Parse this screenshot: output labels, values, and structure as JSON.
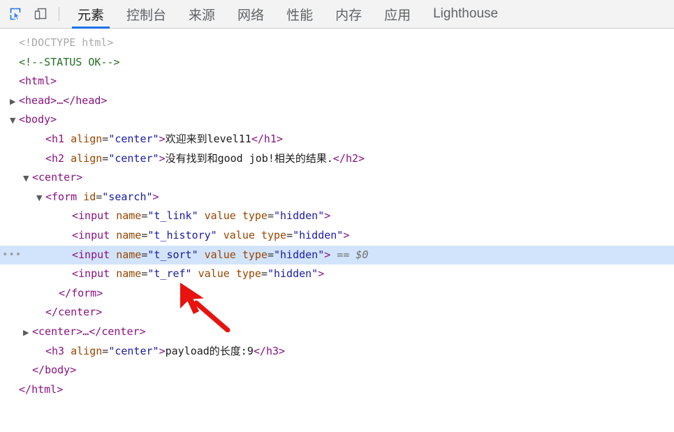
{
  "toolbar": {
    "icons": [
      {
        "name": "inspect-element-icon",
        "label": "Inspect element",
        "active": true
      },
      {
        "name": "device-toolbar-icon",
        "label": "Toggle device toolbar",
        "active": false
      }
    ],
    "tabs": [
      {
        "label": "元素",
        "active": true
      },
      {
        "label": "控制台",
        "active": false
      },
      {
        "label": "来源",
        "active": false
      },
      {
        "label": "网络",
        "active": false
      },
      {
        "label": "性能",
        "active": false
      },
      {
        "label": "内存",
        "active": false
      },
      {
        "label": "应用",
        "active": false
      },
      {
        "label": "Lighthouse",
        "active": false
      }
    ],
    "accent_color": "#1a73e8",
    "background_color": "#f3f3f3"
  },
  "dom_tree": {
    "selection_color": "#d2e4fb",
    "selected_suffix": "== $0",
    "ellipsis_marker": "•••",
    "rows": [
      {
        "twisty": "",
        "indent": 0,
        "segments": [
          {
            "cls": "doctype",
            "t": "<!DOCTYPE html>"
          }
        ]
      },
      {
        "twisty": "",
        "indent": 0,
        "segments": [
          {
            "cls": "comment",
            "t": "<!--STATUS OK-->"
          }
        ]
      },
      {
        "twisty": "",
        "indent": 0,
        "segments": [
          {
            "cls": "punct",
            "t": "<"
          },
          {
            "cls": "tag",
            "t": "html"
          },
          {
            "cls": "punct",
            "t": ">"
          }
        ]
      },
      {
        "twisty": "right",
        "indent": 0,
        "segments": [
          {
            "cls": "punct",
            "t": "<"
          },
          {
            "cls": "tag",
            "t": "head"
          },
          {
            "cls": "punct",
            "t": ">"
          },
          {
            "cls": "dots",
            "t": "…"
          },
          {
            "cls": "punct",
            "t": "</"
          },
          {
            "cls": "tag",
            "t": "head"
          },
          {
            "cls": "punct",
            "t": ">"
          }
        ]
      },
      {
        "twisty": "down",
        "indent": 0,
        "segments": [
          {
            "cls": "punct",
            "t": "<"
          },
          {
            "cls": "tag",
            "t": "body"
          },
          {
            "cls": "punct",
            "t": ">"
          }
        ]
      },
      {
        "twisty": "",
        "indent": 2,
        "segments": [
          {
            "cls": "punct",
            "t": "<"
          },
          {
            "cls": "tag",
            "t": "h1"
          },
          {
            "cls": "plain",
            "t": " "
          },
          {
            "cls": "attr",
            "t": "align"
          },
          {
            "cls": "plain",
            "t": "="
          },
          {
            "cls": "val",
            "t": "\"center\""
          },
          {
            "cls": "punct",
            "t": ">"
          },
          {
            "cls": "text",
            "t": "欢迎来到level11"
          },
          {
            "cls": "punct",
            "t": "</"
          },
          {
            "cls": "tag",
            "t": "h1"
          },
          {
            "cls": "punct",
            "t": ">"
          }
        ]
      },
      {
        "twisty": "",
        "indent": 2,
        "segments": [
          {
            "cls": "punct",
            "t": "<"
          },
          {
            "cls": "tag",
            "t": "h2"
          },
          {
            "cls": "plain",
            "t": " "
          },
          {
            "cls": "attr",
            "t": "align"
          },
          {
            "cls": "plain",
            "t": "="
          },
          {
            "cls": "val",
            "t": "\"center\""
          },
          {
            "cls": "punct",
            "t": ">"
          },
          {
            "cls": "text",
            "t": "没有找到和good job!相关的结果."
          },
          {
            "cls": "punct",
            "t": "</"
          },
          {
            "cls": "tag",
            "t": "h2"
          },
          {
            "cls": "punct",
            "t": ">"
          }
        ]
      },
      {
        "twisty": "down",
        "indent": 1,
        "segments": [
          {
            "cls": "punct",
            "t": "<"
          },
          {
            "cls": "tag",
            "t": "center"
          },
          {
            "cls": "punct",
            "t": ">"
          }
        ]
      },
      {
        "twisty": "down",
        "indent": 2,
        "segments": [
          {
            "cls": "punct",
            "t": "<"
          },
          {
            "cls": "tag",
            "t": "form"
          },
          {
            "cls": "plain",
            "t": " "
          },
          {
            "cls": "attr",
            "t": "id"
          },
          {
            "cls": "plain",
            "t": "="
          },
          {
            "cls": "val",
            "t": "\"search\""
          },
          {
            "cls": "punct",
            "t": ">"
          }
        ]
      },
      {
        "twisty": "",
        "indent": 4,
        "segments": [
          {
            "cls": "punct",
            "t": "<"
          },
          {
            "cls": "tag",
            "t": "input"
          },
          {
            "cls": "plain",
            "t": " "
          },
          {
            "cls": "attr",
            "t": "name"
          },
          {
            "cls": "plain",
            "t": "="
          },
          {
            "cls": "val",
            "t": "\"t_link\""
          },
          {
            "cls": "plain",
            "t": " "
          },
          {
            "cls": "attr",
            "t": "value"
          },
          {
            "cls": "plain",
            "t": " "
          },
          {
            "cls": "attr",
            "t": "type"
          },
          {
            "cls": "plain",
            "t": "="
          },
          {
            "cls": "val",
            "t": "\"hidden\""
          },
          {
            "cls": "punct",
            "t": ">"
          }
        ]
      },
      {
        "twisty": "",
        "indent": 4,
        "segments": [
          {
            "cls": "punct",
            "t": "<"
          },
          {
            "cls": "tag",
            "t": "input"
          },
          {
            "cls": "plain",
            "t": " "
          },
          {
            "cls": "attr",
            "t": "name"
          },
          {
            "cls": "plain",
            "t": "="
          },
          {
            "cls": "val",
            "t": "\"t_history\""
          },
          {
            "cls": "plain",
            "t": " "
          },
          {
            "cls": "attr",
            "t": "value"
          },
          {
            "cls": "plain",
            "t": " "
          },
          {
            "cls": "attr",
            "t": "type"
          },
          {
            "cls": "plain",
            "t": "="
          },
          {
            "cls": "val",
            "t": "\"hidden\""
          },
          {
            "cls": "punct",
            "t": ">"
          }
        ]
      },
      {
        "twisty": "",
        "indent": 4,
        "selected": true,
        "segments": [
          {
            "cls": "punct",
            "t": "<"
          },
          {
            "cls": "tag",
            "t": "input"
          },
          {
            "cls": "plain",
            "t": " "
          },
          {
            "cls": "attr",
            "t": "name"
          },
          {
            "cls": "plain",
            "t": "="
          },
          {
            "cls": "val",
            "t": "\"t_sort\""
          },
          {
            "cls": "plain",
            "t": " "
          },
          {
            "cls": "attr",
            "t": "value"
          },
          {
            "cls": "plain",
            "t": " "
          },
          {
            "cls": "attr",
            "t": "type"
          },
          {
            "cls": "plain",
            "t": "="
          },
          {
            "cls": "val",
            "t": "\"hidden\""
          },
          {
            "cls": "punct",
            "t": ">"
          },
          {
            "cls": "shadow",
            "t": " == $0"
          }
        ]
      },
      {
        "twisty": "",
        "indent": 4,
        "segments": [
          {
            "cls": "punct",
            "t": "<"
          },
          {
            "cls": "tag",
            "t": "input"
          },
          {
            "cls": "plain",
            "t": " "
          },
          {
            "cls": "attr",
            "t": "name"
          },
          {
            "cls": "plain",
            "t": "="
          },
          {
            "cls": "val",
            "t": "\"t_ref\""
          },
          {
            "cls": "plain",
            "t": " "
          },
          {
            "cls": "attr",
            "t": "value"
          },
          {
            "cls": "plain",
            "t": " "
          },
          {
            "cls": "attr",
            "t": "type"
          },
          {
            "cls": "plain",
            "t": "="
          },
          {
            "cls": "val",
            "t": "\"hidden\""
          },
          {
            "cls": "punct",
            "t": ">"
          }
        ]
      },
      {
        "twisty": "",
        "indent": 3,
        "segments": [
          {
            "cls": "punct",
            "t": "</"
          },
          {
            "cls": "tag",
            "t": "form"
          },
          {
            "cls": "punct",
            "t": ">"
          }
        ]
      },
      {
        "twisty": "",
        "indent": 2,
        "segments": [
          {
            "cls": "punct",
            "t": "</"
          },
          {
            "cls": "tag",
            "t": "center"
          },
          {
            "cls": "punct",
            "t": ">"
          }
        ]
      },
      {
        "twisty": "right",
        "indent": 1,
        "segments": [
          {
            "cls": "punct",
            "t": "<"
          },
          {
            "cls": "tag",
            "t": "center"
          },
          {
            "cls": "punct",
            "t": ">"
          },
          {
            "cls": "dots",
            "t": "…"
          },
          {
            "cls": "punct",
            "t": "</"
          },
          {
            "cls": "tag",
            "t": "center"
          },
          {
            "cls": "punct",
            "t": ">"
          }
        ]
      },
      {
        "twisty": "",
        "indent": 2,
        "segments": [
          {
            "cls": "punct",
            "t": "<"
          },
          {
            "cls": "tag",
            "t": "h3"
          },
          {
            "cls": "plain",
            "t": " "
          },
          {
            "cls": "attr",
            "t": "align"
          },
          {
            "cls": "plain",
            "t": "="
          },
          {
            "cls": "val",
            "t": "\"center\""
          },
          {
            "cls": "punct",
            "t": ">"
          },
          {
            "cls": "text",
            "t": "payload的长度:9"
          },
          {
            "cls": "punct",
            "t": "</"
          },
          {
            "cls": "tag",
            "t": "h3"
          },
          {
            "cls": "punct",
            "t": ">"
          }
        ]
      },
      {
        "twisty": "",
        "indent": 1,
        "segments": [
          {
            "cls": "punct",
            "t": "</"
          },
          {
            "cls": "tag",
            "t": "body"
          },
          {
            "cls": "punct",
            "t": ">"
          }
        ]
      },
      {
        "twisty": "",
        "indent": 0,
        "segments": [
          {
            "cls": "punct",
            "t": "</"
          },
          {
            "cls": "tag",
            "t": "html"
          },
          {
            "cls": "punct",
            "t": ">"
          }
        ]
      }
    ]
  },
  "annotation": {
    "arrow_color": "#e8130e",
    "name": "red-pointer-arrow"
  }
}
